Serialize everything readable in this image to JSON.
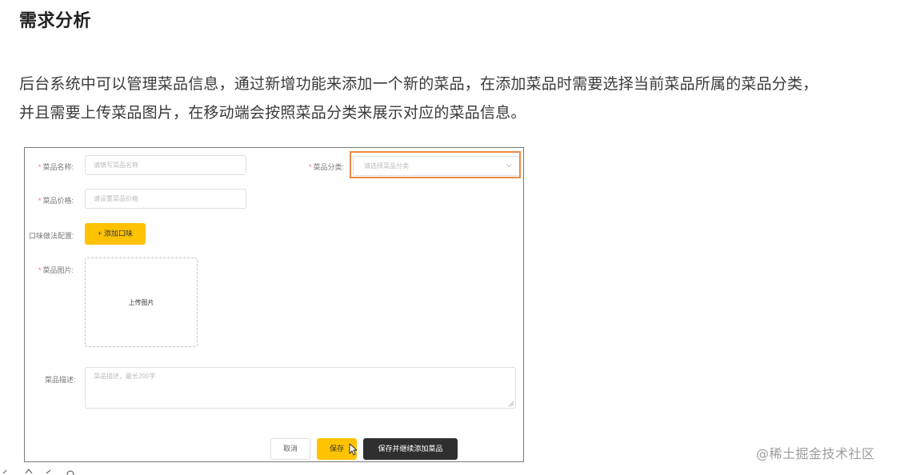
{
  "heading": "需求分析",
  "description": {
    "line1": "后台系统中可以管理菜品信息，通过新增功能来添加一个新的菜品，在添加菜品时需要选择当前菜品所属的菜品分类，",
    "line2": "并且需要上传菜品图片，在移动端会按照菜品分类来展示对应的菜品信息。"
  },
  "form": {
    "dish_name": {
      "required_mark": "*",
      "label": "菜品名称:",
      "placeholder": "请填写菜品名称",
      "value": ""
    },
    "dish_category": {
      "required_mark": "*",
      "label": "菜品分类:",
      "placeholder": "请选择菜品分类",
      "icon": "chevron-down-icon"
    },
    "dish_price": {
      "required_mark": "*",
      "label": "菜品价格:",
      "placeholder": "请设置菜品价格",
      "value": ""
    },
    "flavor_config": {
      "label": "口味做法配置:",
      "add_button_label": "+ 添加口味"
    },
    "dish_image": {
      "required_mark": "*",
      "label": "菜品图片:",
      "upload_label": "上传图片"
    },
    "dish_description": {
      "label": "菜品描述:",
      "placeholder": "菜品描述，最长200字",
      "value": ""
    },
    "actions": {
      "cancel_label": "取消",
      "save_label": "保存",
      "save_continue_label": "保存并继续添加菜品"
    }
  },
  "colors": {
    "primary": "#ffc200",
    "dark_button": "#2f2f2f",
    "highlight": "#ea8a45",
    "required": "#f56c6c"
  },
  "watermark": "@稀土掘金技术社区"
}
